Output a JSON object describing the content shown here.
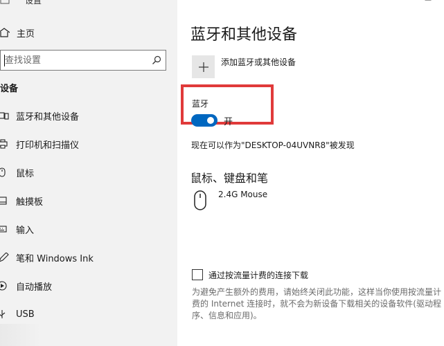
{
  "sidebar": {
    "top_label": "设置",
    "home": {
      "label": "主页",
      "icon": "home-icon"
    },
    "search": {
      "placeholder": "查找设置",
      "icon": "search-icon"
    },
    "section_title": "设备",
    "items": [
      {
        "label": "蓝牙和其他设备",
        "icon": "devices-icon"
      },
      {
        "label": "打印机和扫描仪",
        "icon": "printer-icon"
      },
      {
        "label": "鼠标",
        "icon": "mouse-icon"
      },
      {
        "label": "触摸板",
        "icon": "touchpad-icon"
      },
      {
        "label": "输入",
        "icon": "keyboard-icon"
      },
      {
        "label": "笔和 Windows Ink",
        "icon": "pen-icon"
      },
      {
        "label": "自动播放",
        "icon": "autoplay-icon"
      },
      {
        "label": "USB",
        "icon": "usb-icon"
      }
    ]
  },
  "main": {
    "title": "蓝牙和其他设备",
    "add_device_label": "添加蓝牙或其他设备",
    "bluetooth": {
      "label": "蓝牙",
      "toggle_state": "开",
      "on": true
    },
    "discoverable_text": "现在可以作为\"DESKTOP-04UVNR8\"被发现",
    "mouse_section_title": "鼠标、键盘和笔",
    "device_name": "2.4G Mouse",
    "metered": {
      "checked": false,
      "label": "通过按流量计费的连接下载",
      "description": "为避免产生额外的费用，请始终关闭此功能，这样当你使用按流量计费的 Internet 连接时，就不会为新设备下载相关的设备软件(驱动程序、信息和应用)。"
    }
  },
  "colors": {
    "accent": "#0067c0",
    "highlight": "#e03a3a",
    "sidebar_bg": "#f2f2f2"
  }
}
